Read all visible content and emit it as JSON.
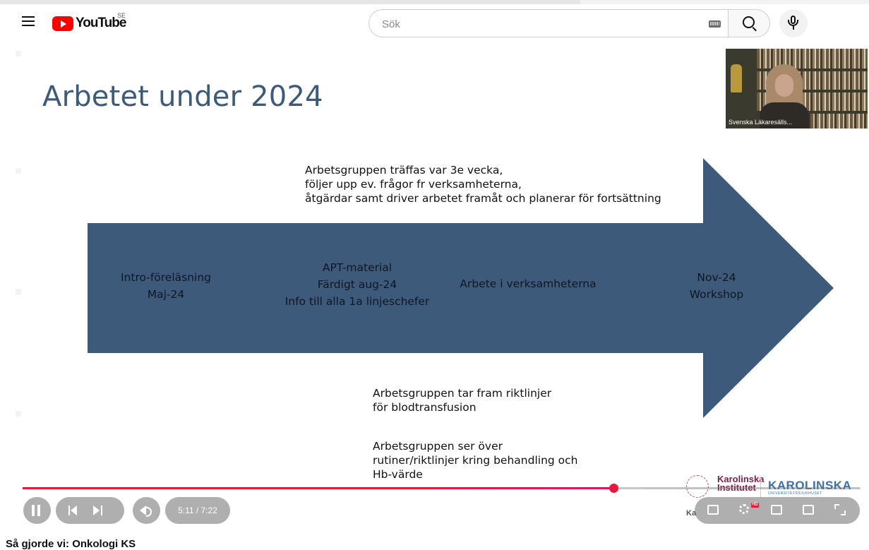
{
  "app": {
    "logo_text": "YouTube",
    "country_code": "SE"
  },
  "search": {
    "placeholder": "Sök"
  },
  "slide": {
    "title": "Arbetet under 2024",
    "top_text": [
      "Arbetsgruppen träffas var 3e vecka,",
      "följer upp ev. frågor fr verksamheterna,",
      "åtgärdar samt driver arbetet framåt och planerar för fortsättning"
    ],
    "arrow_labels": [
      {
        "lines": [
          "Intro-föreläsning",
          "Maj-24"
        ]
      },
      {
        "lines": [
          "APT-material",
          "Färdigt aug-24",
          "Info till alla 1a linjeschefer"
        ]
      },
      {
        "lines": [
          "Arbete i verksamheterna"
        ]
      },
      {
        "lines": [
          "Nov-24",
          "Workshop"
        ]
      }
    ],
    "bottom_text_1": [
      "Arbetsgruppen tar fram riktlinjer",
      "för blodtransfusion"
    ],
    "bottom_text_2": [
      "Arbetsgruppen ser över",
      "rutiner/riktlinjer kring behandling och",
      "Hb-värde"
    ],
    "arrow_color": "#3d5a7a",
    "title_color": "#3e5a79"
  },
  "webcam": {
    "name": "Svenska Läkaresälls..."
  },
  "logos": {
    "ki_line1": "Karolinska",
    "ki_line2": "Institutet",
    "ku_name": "KAROLINSKA",
    "ku_sub": "UNIVERSITETSSJUKHUSET",
    "partial_text": "Ka"
  },
  "player": {
    "time_display": "5:11 / 7:22",
    "progress_fraction": 0.706,
    "buffered_fraction": 0.745,
    "accent_color": "#e8183a"
  },
  "video": {
    "title": "Så gjorde vi: Onkologi KS"
  }
}
